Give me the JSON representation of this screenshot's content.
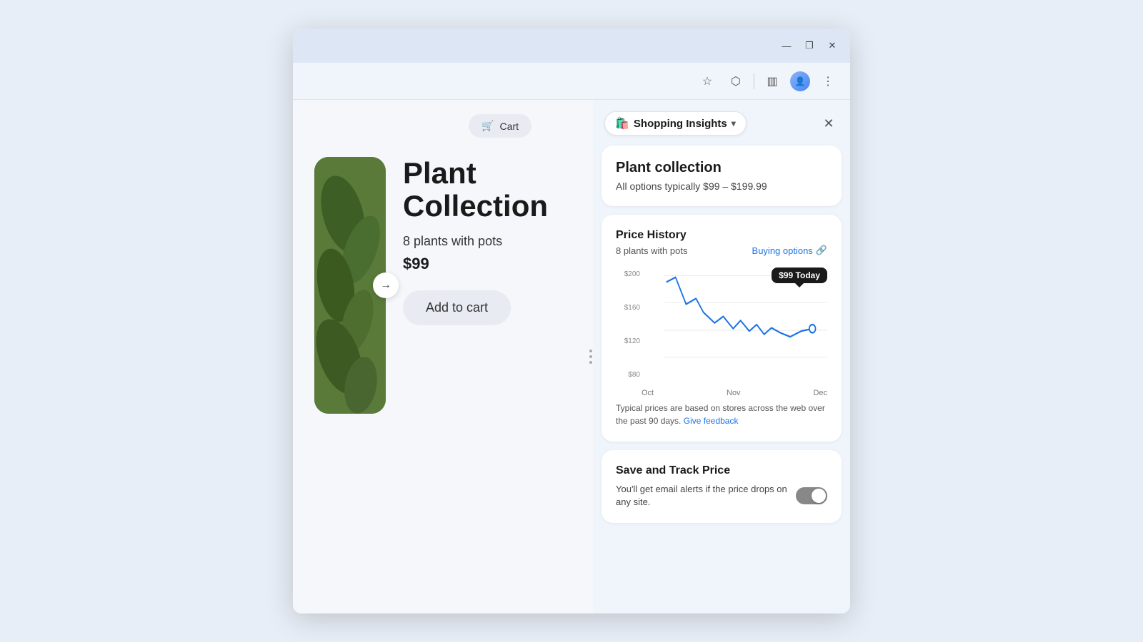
{
  "browser": {
    "titlebar": {
      "minimize": "—",
      "maximize": "❐",
      "close": "✕"
    },
    "toolbar": {
      "bookmark_icon": "☆",
      "extensions_icon": "⬡",
      "sidebar_icon": "▥",
      "menu_icon": "⋮"
    }
  },
  "product": {
    "cart_label": "Cart",
    "title_line1": "Plant",
    "title_line2": "Collection",
    "subtitle": "8 plants with pots",
    "price": "$99",
    "add_to_cart": "Add to cart",
    "nav_arrow": "→"
  },
  "insights": {
    "panel_title": "Shopping Insights",
    "panel_chevron": "▾",
    "close_icon": "✕",
    "product_name": "Plant collection",
    "price_range": "All options typically $99 – $199.99",
    "price_history_title": "Price History",
    "price_history_sub": "8 plants with pots",
    "buying_options_label": "Buying options",
    "external_icon": "↗",
    "tooltip_text": "$99 Today",
    "chart": {
      "y_labels": [
        "$200",
        "$160",
        "$120",
        "$80"
      ],
      "x_labels": [
        "Oct",
        "Nov",
        "Dec"
      ],
      "data_points": [
        {
          "x": 0,
          "y": 0.15
        },
        {
          "x": 0.08,
          "y": 0.12
        },
        {
          "x": 0.14,
          "y": 0.35
        },
        {
          "x": 0.22,
          "y": 0.28
        },
        {
          "x": 0.28,
          "y": 0.42
        },
        {
          "x": 0.36,
          "y": 0.55
        },
        {
          "x": 0.42,
          "y": 0.45
        },
        {
          "x": 0.5,
          "y": 0.6
        },
        {
          "x": 0.56,
          "y": 0.5
        },
        {
          "x": 0.62,
          "y": 0.65
        },
        {
          "x": 0.68,
          "y": 0.58
        },
        {
          "x": 0.72,
          "y": 0.7
        },
        {
          "x": 0.78,
          "y": 0.6
        },
        {
          "x": 0.84,
          "y": 0.68
        },
        {
          "x": 0.9,
          "y": 0.72
        },
        {
          "x": 0.96,
          "y": 0.65
        },
        {
          "x": 1.0,
          "y": 0.62
        }
      ]
    },
    "feedback_text": "Typical prices are based on stores across the web over the past 90 days.",
    "feedback_link": "Give feedback",
    "save_track_title": "Save and Track Price",
    "save_track_desc": "You'll get email alerts if the price drops on any site.",
    "toggle_state": "off"
  }
}
